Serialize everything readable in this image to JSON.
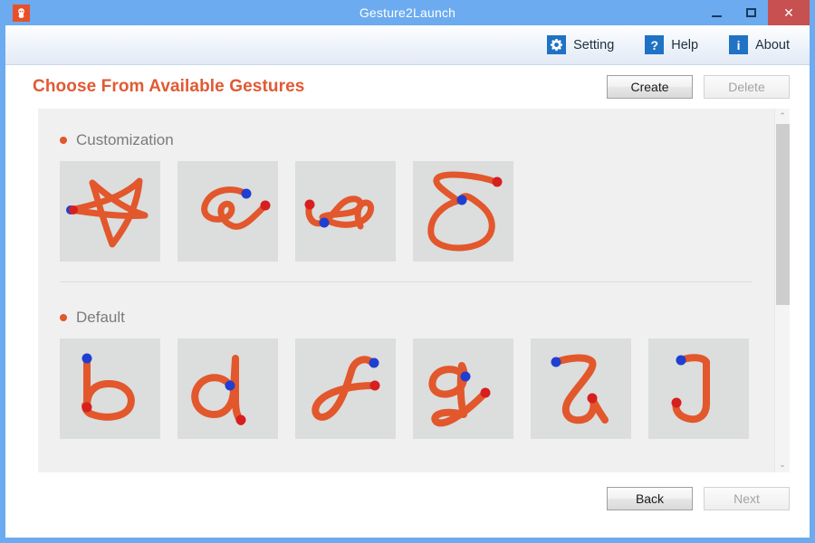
{
  "window": {
    "title": "Gesture2Launch",
    "app_icon": "app-logo-icon",
    "minimize_label": "Minimize",
    "maximize_label": "Maximize",
    "close_label": "✕",
    "border_color": "#6cabf0",
    "titlebar_color": "#6cabf0",
    "close_color": "#c75050"
  },
  "toolbar": {
    "items": [
      {
        "label": "Setting",
        "icon": "gear-icon"
      },
      {
        "label": "Help",
        "icon": "question-mark-icon"
      },
      {
        "label": "About",
        "icon": "info-icon"
      }
    ],
    "icon_color": "#1f72c4"
  },
  "header": {
    "title": "Choose From Available Gestures",
    "title_color": "#e05a33",
    "create_label": "Create",
    "create_enabled": true,
    "delete_label": "Delete",
    "delete_enabled": false
  },
  "panel": {
    "background": "#f0f0f0",
    "stroke_color": "#e2572c",
    "start_dot_color": "#1f3fd0",
    "end_dot_color": "#d61f1f",
    "tile_background": "#dcdddd",
    "groups": [
      {
        "title": "Customization",
        "bullet_color": "#e2572c",
        "gestures": [
          {
            "name": "star"
          },
          {
            "name": "squiggle-right"
          },
          {
            "name": "wave-loop"
          },
          {
            "name": "loop-delta"
          }
        ]
      },
      {
        "title": "Default",
        "bullet_color": "#e2572c",
        "gestures": [
          {
            "name": "letter-b"
          },
          {
            "name": "letter-d"
          },
          {
            "name": "letter-f"
          },
          {
            "name": "letter-g"
          },
          {
            "name": "letter-u"
          },
          {
            "name": "letter-j"
          }
        ]
      }
    ]
  },
  "scrollbar": {
    "up_arrow": "⌃",
    "down_arrow": "⌄",
    "thumb_color": "#cdcdcd"
  },
  "footer": {
    "back_label": "Back",
    "back_enabled": true,
    "next_label": "Next",
    "next_enabled": false
  }
}
